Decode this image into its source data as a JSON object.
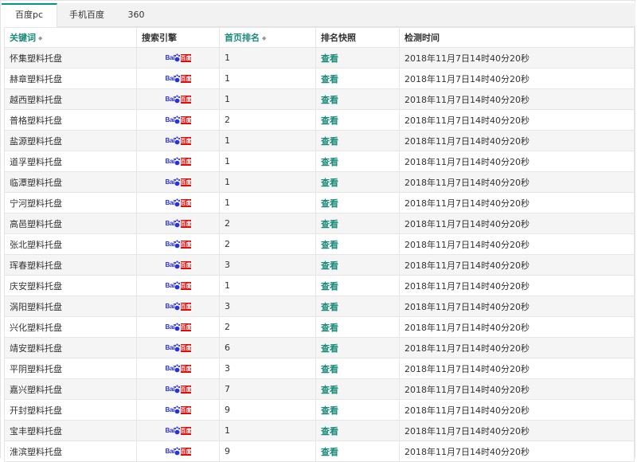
{
  "tabs": [
    {
      "label": "百度pc",
      "active": true
    },
    {
      "label": "手机百度",
      "active": false
    },
    {
      "label": "360",
      "active": false
    }
  ],
  "table": {
    "columns": [
      {
        "label": "关键词",
        "sortable": true
      },
      {
        "label": "搜索引擎",
        "sortable": false
      },
      {
        "label": "首页排名",
        "sortable": true
      },
      {
        "label": "排名快照",
        "sortable": false
      },
      {
        "label": "检测时间",
        "sortable": false
      }
    ],
    "engine_logo": {
      "prefix": "Bai",
      "suffix": "百度",
      "icon": "baidu-paw-icon",
      "color_blue": "#2932e1",
      "color_red": "#e10601"
    },
    "rows": [
      {
        "keyword": "怀集塑料托盘",
        "rank": "1",
        "snapshot": "查看",
        "time": "2018年11月7日14时40分20秒"
      },
      {
        "keyword": "赫章塑料托盘",
        "rank": "1",
        "snapshot": "查看",
        "time": "2018年11月7日14时40分20秒"
      },
      {
        "keyword": "越西塑料托盘",
        "rank": "1",
        "snapshot": "查看",
        "time": "2018年11月7日14时40分20秒"
      },
      {
        "keyword": "普格塑料托盘",
        "rank": "2",
        "snapshot": "查看",
        "time": "2018年11月7日14时40分20秒"
      },
      {
        "keyword": "盐源塑料托盘",
        "rank": "1",
        "snapshot": "查看",
        "time": "2018年11月7日14时40分20秒"
      },
      {
        "keyword": "道孚塑料托盘",
        "rank": "1",
        "snapshot": "查看",
        "time": "2018年11月7日14时40分20秒"
      },
      {
        "keyword": "临潭塑料托盘",
        "rank": "1",
        "snapshot": "查看",
        "time": "2018年11月7日14时40分20秒"
      },
      {
        "keyword": "宁河塑料托盘",
        "rank": "1",
        "snapshot": "查看",
        "time": "2018年11月7日14时40分20秒"
      },
      {
        "keyword": "高邑塑料托盘",
        "rank": "2",
        "snapshot": "查看",
        "time": "2018年11月7日14时40分20秒"
      },
      {
        "keyword": "张北塑料托盘",
        "rank": "2",
        "snapshot": "查看",
        "time": "2018年11月7日14时40分20秒"
      },
      {
        "keyword": "珲春塑料托盘",
        "rank": "3",
        "snapshot": "查看",
        "time": "2018年11月7日14时40分20秒"
      },
      {
        "keyword": "庆安塑料托盘",
        "rank": "1",
        "snapshot": "查看",
        "time": "2018年11月7日14时40分20秒"
      },
      {
        "keyword": "涡阳塑料托盘",
        "rank": "3",
        "snapshot": "查看",
        "time": "2018年11月7日14时40分20秒"
      },
      {
        "keyword": "兴化塑料托盘",
        "rank": "2",
        "snapshot": "查看",
        "time": "2018年11月7日14时40分20秒"
      },
      {
        "keyword": "靖安塑料托盘",
        "rank": "6",
        "snapshot": "查看",
        "time": "2018年11月7日14时40分20秒"
      },
      {
        "keyword": "平阴塑料托盘",
        "rank": "3",
        "snapshot": "查看",
        "time": "2018年11月7日14时40分20秒"
      },
      {
        "keyword": "嘉兴塑料托盘",
        "rank": "7",
        "snapshot": "查看",
        "time": "2018年11月7日14时40分20秒"
      },
      {
        "keyword": "开封塑料托盘",
        "rank": "9",
        "snapshot": "查看",
        "time": "2018年11月7日14时40分20秒"
      },
      {
        "keyword": "宝丰塑料托盘",
        "rank": "1",
        "snapshot": "查看",
        "time": "2018年11月7日14时40分20秒"
      },
      {
        "keyword": "淮滨塑料托盘",
        "rank": "9",
        "snapshot": "查看",
        "time": "2018年11月7日14时40分20秒"
      }
    ]
  }
}
